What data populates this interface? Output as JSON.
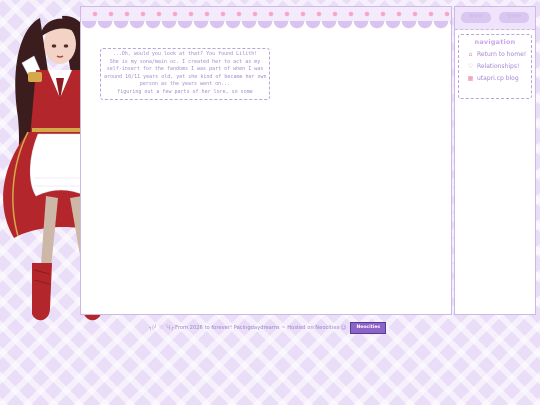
{
  "intro": {
    "lines": [
      "...Oh, would you look at that? You found Lilith!",
      "She is my sona/main oc. I created her to act as my",
      "self-insert for the fandoms I was part of when I was",
      "around 10/11 years old, yet she kind of became her own",
      "person as the years went on...",
      "figuring out a few parts of her lore, so some"
    ]
  },
  "sidebar": {
    "top_buttons": [
      "♡♡♡",
      "♡♡♡"
    ],
    "nav_title": "navigation",
    "items": [
      {
        "icon": "home-icon",
        "glyph": "⌂",
        "label": "Return to home!"
      },
      {
        "icon": "heart-icon",
        "glyph": "♡",
        "label": "Relationships!"
      },
      {
        "icon": "blog-icon",
        "glyph": "▦",
        "label": "utapri.cp blog"
      }
    ]
  },
  "footer": {
    "text": "╮(╯ ♡ ╰)╭ From 2026 to forever! Pacingdaydreams ~ Hosted on Neocities ☺",
    "badge": "Neocities"
  },
  "colors": {
    "background": "#e9ddf7",
    "accent": "#a585d3",
    "dress_red": "#b3262b",
    "border": "#cdb8e6"
  }
}
